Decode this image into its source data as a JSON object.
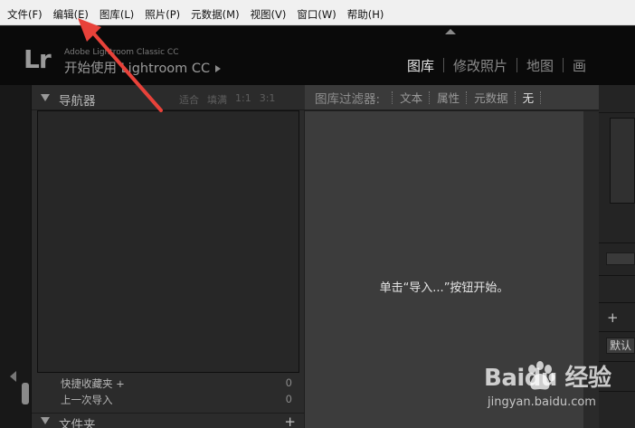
{
  "menubar": {
    "items": [
      "文件(F)",
      "编辑(E)",
      "图库(L)",
      "照片(P)",
      "元数据(M)",
      "视图(V)",
      "窗口(W)",
      "帮助(H)"
    ]
  },
  "identity": {
    "version": "Adobe Lightroom Classic CC",
    "start": "开始使用 Lightroom CC",
    "modules": [
      "图库",
      "修改照片",
      "地图",
      "画"
    ]
  },
  "navigator": {
    "title": "导航器",
    "zoom_options": [
      "适合",
      "填满",
      "1:1",
      "3:1"
    ]
  },
  "collections": [
    {
      "label": "快捷收藏夹 +",
      "count": "0"
    },
    {
      "label": "上一次导入",
      "count": "0"
    }
  ],
  "folders": {
    "title": "文件夹",
    "add": "+"
  },
  "filter": {
    "label": "图库过滤器:",
    "options": [
      "文本",
      "属性",
      "元数据",
      "无"
    ]
  },
  "grid": {
    "hint": "单击“导入...”按钮开始。"
  },
  "right_panel": {
    "add": "+",
    "default_label": "默认"
  },
  "watermark": {
    "brand": "Baidu 经验",
    "url": "jingyan.baidu.com"
  },
  "colors": {
    "accent_arrow": "#e8423a",
    "active_module": "#e8e8e8",
    "panel_bg": "#2b2b2b",
    "grid_bg": "#3c3c3c"
  }
}
